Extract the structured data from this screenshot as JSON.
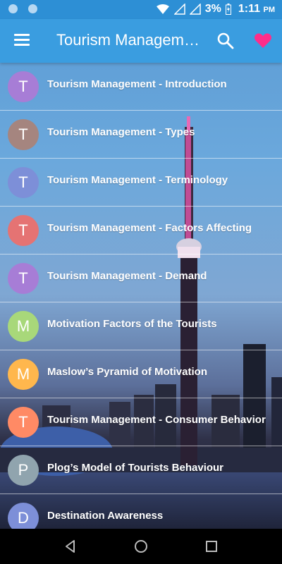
{
  "status": {
    "battery": "3%",
    "time": "1:11",
    "ampm": "PM"
  },
  "app": {
    "title": "Tourism Managem…"
  },
  "colors": {
    "status_bar": "#2d8fd5",
    "app_bar": "#3a9de0",
    "heart": "#ff2d8a"
  },
  "list": {
    "items": [
      {
        "initial": "T",
        "label": "Tourism Management - Introduction",
        "color": "#a77dd6"
      },
      {
        "initial": "T",
        "label": "Tourism Management - Types",
        "color": "#a5857f"
      },
      {
        "initial": "T",
        "label": "Tourism Management - Terminology",
        "color": "#7d8fd8"
      },
      {
        "initial": "T",
        "label": "Tourism Management - Factors Affecting",
        "color": "#e57373"
      },
      {
        "initial": "T",
        "label": "Tourism Management - Demand",
        "color": "#a77dd6"
      },
      {
        "initial": "M",
        "label": "Motivation Factors of the Tourists",
        "color": "#a8d87a"
      },
      {
        "initial": "M",
        "label": "Maslow’s Pyramid of Motivation",
        "color": "#ffb74d"
      },
      {
        "initial": "T",
        "label": "Tourism Management - Consumer Behavior",
        "color": "#ff8a65"
      },
      {
        "initial": "P",
        "label": "Plog’s Model of Tourists Behaviour",
        "color": "#90a4ae"
      },
      {
        "initial": "D",
        "label": "Destination Awareness",
        "color": "#7d8fd8"
      }
    ]
  }
}
